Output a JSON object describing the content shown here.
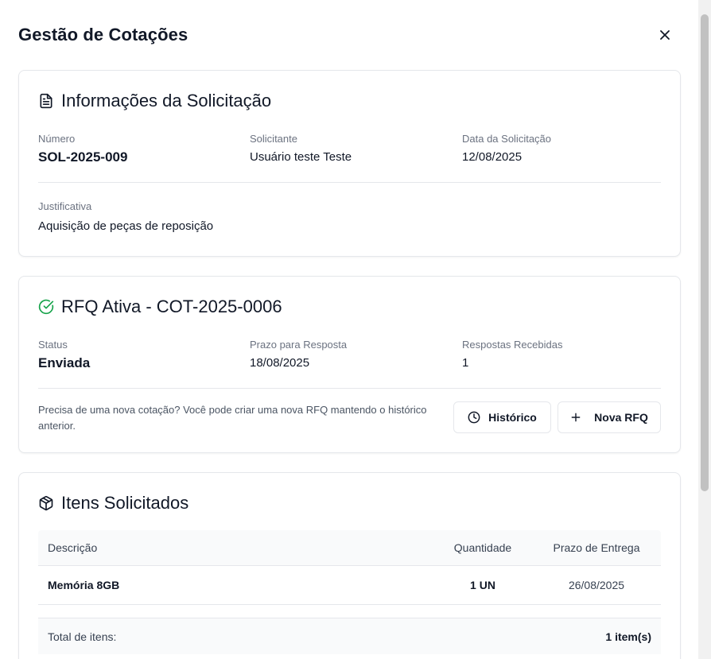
{
  "modal": {
    "title": "Gestão de Cotações",
    "close_icon": "close-icon"
  },
  "solicitacao": {
    "title": "Informações da Solicitação",
    "icon": "file-text-icon",
    "numero_label": "Número",
    "numero_value": "SOL-2025-009",
    "solicitante_label": "Solicitante",
    "solicitante_value": "Usuário teste Teste",
    "data_label": "Data da Solicitação",
    "data_value": "12/08/2025",
    "justificativa_label": "Justificativa",
    "justificativa_value": "Aquisição de peças de reposição"
  },
  "rfq": {
    "title": "RFQ Ativa - COT-2025-0006",
    "icon": "check-circle-icon",
    "icon_color": "#16a34a",
    "status_label": "Status",
    "status_value": "Enviada",
    "prazo_label": "Prazo para Resposta",
    "prazo_value": "18/08/2025",
    "respostas_label": "Respostas Recebidas",
    "respostas_value": "1",
    "hint": "Precisa de uma nova cotação? Você pode criar uma nova RFQ mantendo o histórico anterior.",
    "historico_label": "Histórico",
    "historico_icon": "clock-icon",
    "nova_label": "Nova RFQ",
    "nova_icon": "plus-icon"
  },
  "itens": {
    "title": "Itens Solicitados",
    "icon": "package-icon",
    "columns": [
      "Descrição",
      "Quantidade",
      "Prazo de Entrega"
    ],
    "rows": [
      {
        "descricao": "Memória 8GB",
        "quantidade": "1 UN",
        "prazo": "26/08/2025"
      }
    ],
    "total_label": "Total de itens:",
    "total_value": "1 item(s)"
  }
}
